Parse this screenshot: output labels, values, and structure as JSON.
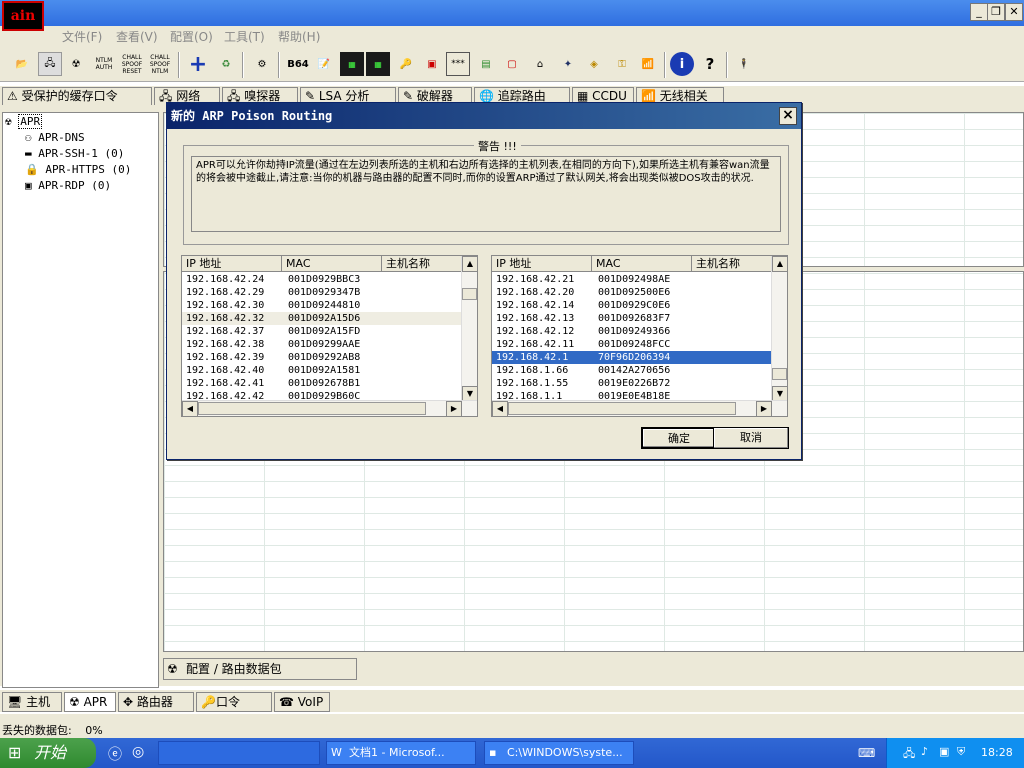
{
  "menu": [
    "文件(F)",
    "查看(V)",
    "配置(O)",
    "工具(T)",
    "帮助(H)"
  ],
  "toolbar_labels": {
    "ntlm": "NTLM AUTH",
    "chall1": "CHALL SPOOF RESET",
    "chall2": "CHALL SPOOF NTLM",
    "b64": "B64",
    "pass": "***"
  },
  "top_tabs": [
    "受保护的缓存口令",
    "网络",
    "嗅探器",
    "LSA 分析",
    "破解器",
    "追踪路由",
    "CCDU",
    "无线相关"
  ],
  "tree": {
    "root": "APR",
    "items": [
      "APR-DNS",
      "APR-SSH-1  (0)",
      "APR-HTTPS  (0)",
      "APR-RDP  (0)"
    ]
  },
  "config_tab": "配置 / 路由数据包",
  "bottom_tabs": [
    "主机",
    "APR",
    "路由器",
    "口令",
    "VoIP"
  ],
  "status": {
    "label": "丢失的数据包:",
    "value": "0%"
  },
  "taskbar": {
    "start": "开始",
    "tasks": [
      "文档1 - Microsof...",
      "C:\\WINDOWS\\syste..."
    ],
    "clock": "18:28"
  },
  "dialog": {
    "title": "新的 ARP Poison Routing",
    "warn_title": "警告 !!!",
    "warn_text": "APR可以允许你劫持IP流量(通过在左边列表所选的主机和右边所有选择的主机列表,在相同的方向下),如果所选主机有兼容wan流量的将会被中途截止,请注意:当你的机器与路由器的配置不同时,而你的设置ARP通过了默认网关,将会出现类似被DOS攻击的状况.",
    "columns": [
      "IP 地址",
      "MAC",
      "主机名称"
    ],
    "left_rows": [
      [
        "192.168.42.24",
        "001D0929BBC3",
        ""
      ],
      [
        "192.168.42.29",
        "001D0929347B",
        ""
      ],
      [
        "192.168.42.30",
        "001D09244810",
        ""
      ],
      [
        "192.168.42.32",
        "001D092A15D6",
        ""
      ],
      [
        "192.168.42.37",
        "001D092A15FD",
        ""
      ],
      [
        "192.168.42.38",
        "001D09299AAE",
        ""
      ],
      [
        "192.168.42.39",
        "001D09292AB8",
        ""
      ],
      [
        "192.168.42.40",
        "001D092A1581",
        ""
      ],
      [
        "192.168.42.41",
        "001D092678B1",
        ""
      ],
      [
        "192.168.42.42",
        "001D0929B60C",
        ""
      ]
    ],
    "right_rows": [
      [
        "192.168.42.21",
        "001D092498AE",
        ""
      ],
      [
        "192.168.42.20",
        "001D092500E6",
        ""
      ],
      [
        "192.168.42.14",
        "001D0929C0E6",
        ""
      ],
      [
        "192.168.42.13",
        "001D092683F7",
        ""
      ],
      [
        "192.168.42.12",
        "001D09249366",
        ""
      ],
      [
        "192.168.42.11",
        "001D09248FCC",
        ""
      ],
      [
        "192.168.42.1",
        "70F96D206394",
        ""
      ],
      [
        "192.168.1.66",
        "00142A270656",
        ""
      ],
      [
        "192.168.1.55",
        "0019E0226B72",
        ""
      ],
      [
        "192.168.1.1",
        "0019E0E4B18E",
        ""
      ]
    ],
    "ok": "确定",
    "cancel": "取消"
  },
  "colors": {
    "titlebar": "#2f6ee0",
    "selection": "#316ac5",
    "taskbar": "#2357c9"
  }
}
